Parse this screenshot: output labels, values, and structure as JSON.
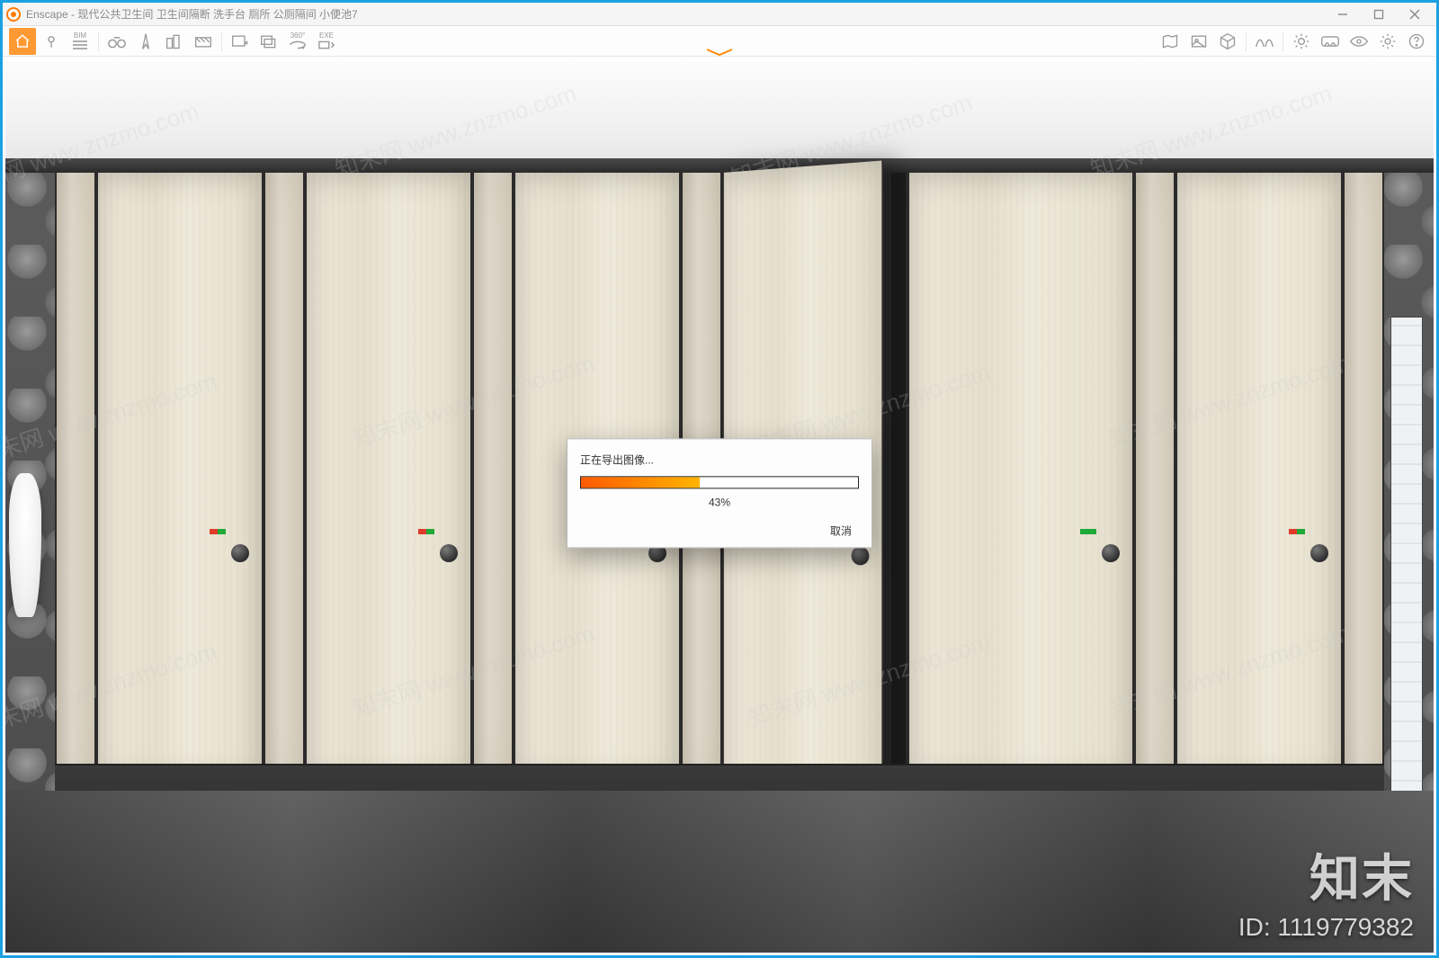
{
  "window": {
    "app_name": "Enscape",
    "title": "Enscape - 现代公共卫生间 卫生间隔断 洗手台 厕所 公厕隔间 小便池7",
    "controls": {
      "minimize": "–",
      "maximize": "▢",
      "close": "✕"
    }
  },
  "toolbar": {
    "left": [
      {
        "name": "home-icon"
      },
      {
        "name": "pin-icon"
      },
      {
        "name": "bim-icon",
        "label": "BIM"
      },
      {
        "name": "binoculars-icon"
      },
      {
        "name": "compass-icon"
      },
      {
        "name": "buildings-icon"
      },
      {
        "name": "clapper-icon"
      },
      {
        "name": "screenshot-icon"
      },
      {
        "name": "batch-render-icon"
      },
      {
        "name": "pano-360-icon",
        "label": "360°"
      },
      {
        "name": "exe-export-icon",
        "label": "EXE"
      }
    ],
    "right": [
      {
        "name": "map-icon"
      },
      {
        "name": "asset-library-icon"
      },
      {
        "name": "cube-icon"
      },
      {
        "name": "bridge-icon"
      },
      {
        "name": "sun-icon"
      },
      {
        "name": "vr-headset-icon"
      },
      {
        "name": "eye-icon"
      },
      {
        "name": "settings-icon"
      },
      {
        "name": "help-icon"
      }
    ]
  },
  "dialog": {
    "message": "正在导出图像...",
    "percent": 43,
    "percent_label": "43%",
    "cancel": "取消"
  },
  "watermark": {
    "diag_text": "知末网 www.znzmo.com",
    "brand": "知末",
    "id_label": "ID: 1119779382"
  }
}
